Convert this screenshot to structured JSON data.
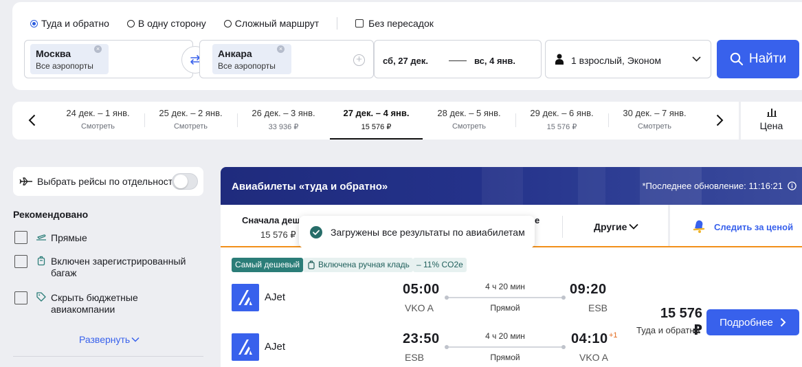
{
  "search": {
    "trip_types": [
      "Туда и обратно",
      "В одну сторону",
      "Сложный маршрут"
    ],
    "nonstop_label": "Без пересадок",
    "from": {
      "city": "Москва",
      "airports": "Все аэропорты"
    },
    "to": {
      "city": "Анкара",
      "airports": "Все аэропорты"
    },
    "depart_date": "сб, 27 дек.",
    "return_date": "вс, 4 янв.",
    "passengers": "1 взрослый, Эконом",
    "search_button": "Найти"
  },
  "date_strip": {
    "cells": [
      {
        "label": "24 дек. – 1 янв.",
        "price": "Смотреть"
      },
      {
        "label": "25 дек. – 2 янв.",
        "price": "Смотреть"
      },
      {
        "label": "26 дек. – 3 янв.",
        "price": "33 936 ₽"
      },
      {
        "label": "27 дек. – 4 янв.",
        "price": "15 576 ₽"
      },
      {
        "label": "28 дек. – 5 янв.",
        "price": "Смотреть"
      },
      {
        "label": "29 дек. – 6 янв.",
        "price": "15 576 ₽"
      },
      {
        "label": "30 дек. – 7 янв.",
        "price": "Смотреть"
      }
    ],
    "chart_label": "Цена"
  },
  "filters": {
    "separate_flights_label": "Выбрать рейсы по отдельности",
    "recommended_title": "Рекомендовано",
    "items": [
      "Прямые",
      "Включен зарегистрированный багаж",
      "Скрыть бюджетные авиакомпании"
    ],
    "expand_label": "Развернуть"
  },
  "results": {
    "banner_title": "Авиабилеты «туда и обратно»",
    "last_update": "*Последнее обновление: 11:16:21",
    "sort": {
      "cheapest_label": "Сначала дешевые",
      "cheapest_price": "15 576 ₽",
      "hidden_tail": "е",
      "other_label": "Другие",
      "track_label": "Следить за ценой"
    },
    "toast": "Загружены все результаты по авиабилетам",
    "badges": {
      "cheapest": "Самый дешевый",
      "hand_luggage": "Включена ручная кладь",
      "co2": "– 11% CO2e"
    },
    "legs": [
      {
        "airline": "AJet",
        "dep_time": "05:00",
        "dep_airport": "VKO A",
        "arr_time": "09:20",
        "arr_airport": "ESB",
        "duration": "4 ч 20 мин",
        "stops": "Прямой",
        "day_shift": ""
      },
      {
        "airline": "AJet",
        "dep_time": "23:50",
        "dep_airport": "ESB",
        "arr_time": "04:10",
        "arr_airport": "VKO A",
        "duration": "4 ч 20 мин",
        "stops": "Прямой",
        "day_shift": "+1"
      }
    ],
    "price": "15 576 ₽",
    "price_note": "Туда и обратно",
    "details_button": "Подробнее"
  },
  "colors": {
    "accent": "#3861ec",
    "banner": "#24328a",
    "sort_underline": "#f28f18",
    "cheapest_badge": "#2b7d78",
    "info_badge_bg": "#e7f1f0"
  }
}
